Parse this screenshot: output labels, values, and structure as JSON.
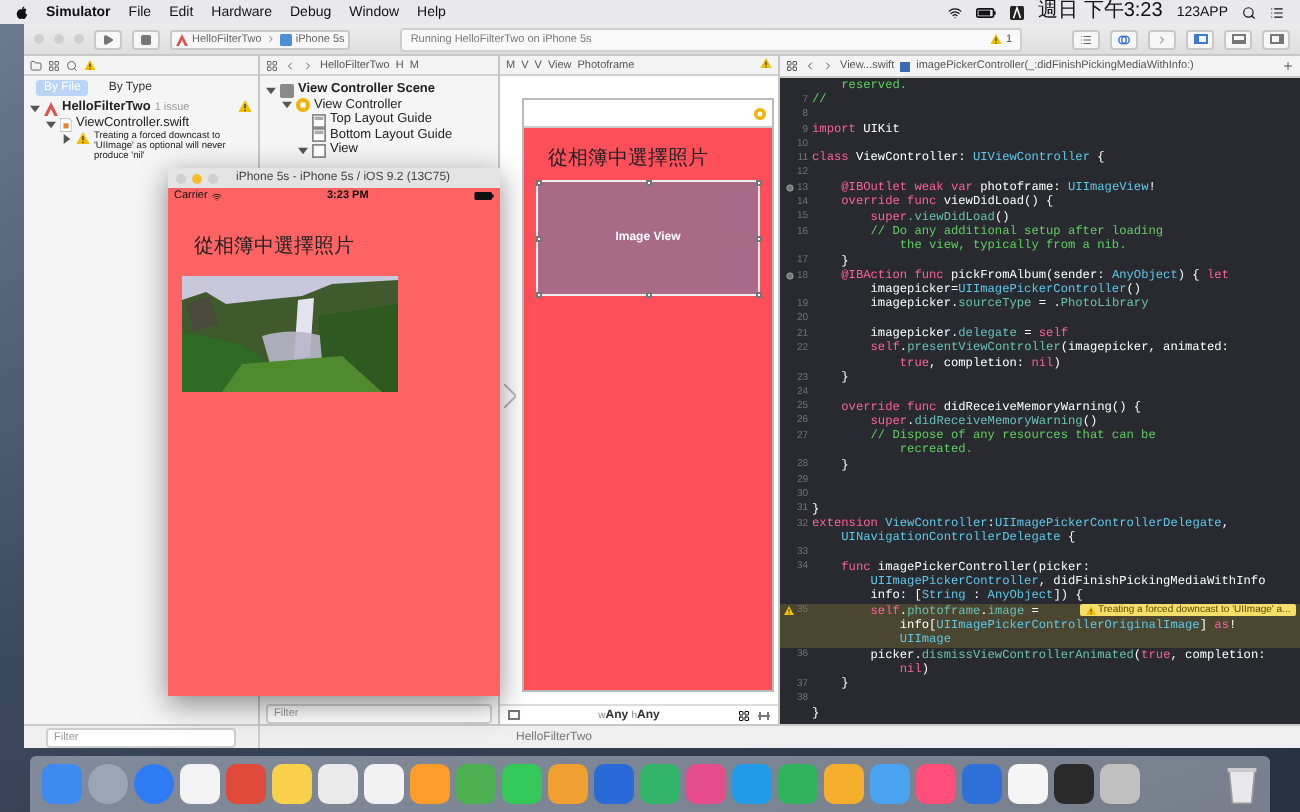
{
  "menu_bar": {
    "app": "Simulator",
    "items": [
      "File",
      "Edit",
      "Hardware",
      "Debug",
      "Window",
      "Help"
    ],
    "clock": "週日 下午3:23",
    "user": "123APP"
  },
  "toolbar": {
    "scheme": "HelloFilterTwo",
    "device": "iPhone 5s",
    "activity": "Running HelloFilterTwo on iPhone 5s",
    "issue_count": "1"
  },
  "navigator": {
    "filters": [
      {
        "label": "By File",
        "selected": true
      },
      {
        "label": "By Type",
        "selected": false
      }
    ],
    "issues": [
      {
        "label": "HelloFilterTwo",
        "kind": "project",
        "note": "1 issue",
        "expanded": true,
        "children": [
          {
            "label": "ViewController.swift",
            "kind": "file",
            "expanded": true,
            "children": [
              {
                "label": "Treating a forced downcast to 'UIImage' as optional will never produce 'nil'",
                "kind": "warning",
                "expanded": false
              }
            ]
          }
        ]
      }
    ],
    "filter_placeholder": "Filter"
  },
  "outline": {
    "path": [
      "HelloFilterTwo",
      "H",
      "M"
    ],
    "items": [
      {
        "label": "View Controller Scene",
        "kind": "scene",
        "expanded": true,
        "children": [
          {
            "label": "View Controller",
            "kind": "controller",
            "expanded": true,
            "children": [
              {
                "label": "Top Layout Guide",
                "kind": "guide"
              },
              {
                "label": "Bottom Layout Guide",
                "kind": "guide"
              },
              {
                "label": "View",
                "kind": "view",
                "expanded": true
              }
            ]
          }
        ]
      }
    ],
    "filter_placeholder": "Filter"
  },
  "canvas": {
    "path": [
      "M",
      "V",
      "V",
      "View",
      "Photoframe"
    ],
    "label": "從相簿中選擇照片",
    "image_view": "Image View",
    "size_class": [
      {
        "axis": "w",
        "value": "Any"
      },
      {
        "axis": "h",
        "value": "Any"
      }
    ]
  },
  "editor": {
    "path": [
      "View...swift",
      "imagePickerController(_:didFinishPickingMediaWithInfo:)"
    ],
    "rows": [
      {
        "i": "    ",
        "tk": [
          {
            "text": "reserved.",
            "kind": "comment"
          }
        ]
      },
      {
        "n": "7",
        "tk": [
          {
            "text": "//",
            "kind": "comment"
          }
        ]
      },
      {
        "n": "8"
      },
      {
        "n": "9",
        "tk": [
          {
            "text": "import",
            "kind": "keyword"
          },
          {
            "text": " UIKit",
            "kind": "plain"
          }
        ]
      },
      {
        "n": "10"
      },
      {
        "n": "11",
        "tk": [
          {
            "text": "class",
            "kind": "keyword"
          },
          {
            "text": " ViewController: ",
            "kind": "plain"
          },
          {
            "text": "UIViewController",
            "kind": "type"
          },
          {
            "text": " {",
            "kind": "plain"
          }
        ]
      },
      {
        "n": "12"
      },
      {
        "n": "13",
        "outlet": true,
        "i": "    ",
        "tk": [
          {
            "text": "@IBOutlet weak var",
            "kind": "keyword"
          },
          {
            "text": " photoframe: ",
            "kind": "plain"
          },
          {
            "text": "UIImageView",
            "kind": "type"
          },
          {
            "text": "!",
            "kind": "plain"
          }
        ]
      },
      {
        "n": "14",
        "i": "    ",
        "tk": [
          {
            "text": "override func",
            "kind": "keyword"
          },
          {
            "text": " viewDidLoad() {",
            "kind": "plain"
          }
        ]
      },
      {
        "n": "15",
        "i": "        ",
        "tk": [
          {
            "text": "super",
            "kind": "keyword"
          },
          {
            "text": ".viewDidLoad",
            "kind": "member"
          },
          {
            "text": "()",
            "kind": "plain"
          }
        ]
      },
      {
        "n": "16",
        "i": "        ",
        "tk": [
          {
            "text": "// Do any additional setup after loading",
            "kind": "comment"
          }
        ]
      },
      {
        "i": "            ",
        "tk": [
          {
            "text": "the view, typically from a nib.",
            "kind": "comment"
          }
        ]
      },
      {
        "n": "17",
        "i": "    ",
        "tk": [
          {
            "text": "}",
            "kind": "plain"
          }
        ]
      },
      {
        "n": "18",
        "outlet": true,
        "i": "    ",
        "tk": [
          {
            "text": "@IBAction func",
            "kind": "keyword"
          },
          {
            "text": " pickFromAlbum(sender: ",
            "kind": "plain"
          },
          {
            "text": "AnyObject",
            "kind": "type"
          },
          {
            "text": ") { ",
            "kind": "plain"
          },
          {
            "text": "let",
            "kind": "keyword"
          }
        ]
      },
      {
        "i": "        ",
        "tk": [
          {
            "text": "imagepicker=",
            "kind": "plain"
          },
          {
            "text": "UIImagePickerController",
            "kind": "type"
          },
          {
            "text": "()",
            "kind": "plain"
          }
        ]
      },
      {
        "n": "19",
        "i": "        ",
        "tk": [
          {
            "text": "imagepicker.",
            "kind": "plain"
          },
          {
            "text": "sourceType",
            "kind": "member"
          },
          {
            "text": " = .",
            "kind": "plain"
          },
          {
            "text": "PhotoLibrary",
            "kind": "member"
          }
        ]
      },
      {
        "n": "20"
      },
      {
        "n": "21",
        "i": "        ",
        "tk": [
          {
            "text": "imagepicker.",
            "kind": "plain"
          },
          {
            "text": "delegate",
            "kind": "member"
          },
          {
            "text": " = ",
            "kind": "plain"
          },
          {
            "text": "self",
            "kind": "keyword"
          }
        ]
      },
      {
        "n": "22",
        "i": "        ",
        "tk": [
          {
            "text": "self",
            "kind": "keyword"
          },
          {
            "text": ".",
            "kind": "plain"
          },
          {
            "text": "presentViewController",
            "kind": "member"
          },
          {
            "text": "(imagepicker, animated:",
            "kind": "plain"
          }
        ]
      },
      {
        "i": "            ",
        "tk": [
          {
            "text": "true",
            "kind": "keyword"
          },
          {
            "text": ", completion: ",
            "kind": "plain"
          },
          {
            "text": "nil",
            "kind": "keyword"
          },
          {
            "text": ")",
            "kind": "plain"
          }
        ]
      },
      {
        "n": "23",
        "i": "    ",
        "tk": [
          {
            "text": "}",
            "kind": "plain"
          }
        ]
      },
      {
        "n": "24"
      },
      {
        "n": "25",
        "i": "    ",
        "tk": [
          {
            "text": "override func",
            "kind": "keyword"
          },
          {
            "text": " didReceiveMemoryWarning() {",
            "kind": "plain"
          }
        ]
      },
      {
        "n": "26",
        "i": "        ",
        "tk": [
          {
            "text": "super",
            "kind": "keyword"
          },
          {
            "text": ".",
            "kind": "plain"
          },
          {
            "text": "didReceiveMemoryWarning",
            "kind": "member"
          },
          {
            "text": "()",
            "kind": "plain"
          }
        ]
      },
      {
        "n": "27",
        "i": "        ",
        "tk": [
          {
            "text": "// Dispose of any resources that can be",
            "kind": "comment"
          }
        ]
      },
      {
        "i": "            ",
        "tk": [
          {
            "text": "recreated.",
            "kind": "comment"
          }
        ]
      },
      {
        "n": "28",
        "i": "    ",
        "tk": [
          {
            "text": "}",
            "kind": "plain"
          }
        ]
      },
      {
        "n": "29"
      },
      {
        "n": "30"
      },
      {
        "n": "31",
        "tk": [
          {
            "text": "}",
            "kind": "plain"
          }
        ]
      },
      {
        "n": "32",
        "tk": [
          {
            "text": "extension",
            "kind": "keyword"
          },
          {
            "text": " ViewController",
            "kind": "type"
          },
          {
            "text": ":",
            "kind": "plain"
          },
          {
            "text": "UIImagePickerControllerDelegate",
            "kind": "type"
          },
          {
            "text": ",",
            "kind": "plain"
          }
        ]
      },
      {
        "i": "    ",
        "tk": [
          {
            "text": "UINavigationControllerDelegate",
            "kind": "type"
          },
          {
            "text": " {",
            "kind": "plain"
          }
        ]
      },
      {
        "n": "33"
      },
      {
        "n": "34",
        "i": "    ",
        "tk": [
          {
            "text": "func",
            "kind": "keyword"
          },
          {
            "text": " imagePickerController(picker:",
            "kind": "plain"
          }
        ]
      },
      {
        "i": "        ",
        "tk": [
          {
            "text": "UIImagePickerController",
            "kind": "type"
          },
          {
            "text": ", didFinishPickingMediaWithInfo",
            "kind": "plain"
          }
        ]
      },
      {
        "i": "        ",
        "tk": [
          {
            "text": "info: [",
            "kind": "plain"
          },
          {
            "text": "String",
            "kind": "type"
          },
          {
            "text": " : ",
            "kind": "plain"
          },
          {
            "text": "AnyObject",
            "kind": "type"
          },
          {
            "text": "]) {",
            "kind": "plain"
          }
        ]
      },
      {
        "n": "35",
        "warning": true,
        "issue": "Treating a forced downcast to 'UIImage' a...",
        "i": "        ",
        "tk": [
          {
            "text": "self",
            "kind": "keyword"
          },
          {
            "text": ".",
            "kind": "plain"
          },
          {
            "text": "photoframe",
            "kind": "member"
          },
          {
            "text": ".",
            "kind": "plain"
          },
          {
            "text": "image",
            "kind": "member"
          },
          {
            "text": " =",
            "kind": "plain"
          }
        ]
      },
      {
        "warning": true,
        "i": "            ",
        "tk": [
          {
            "text": "info[",
            "kind": "plain"
          },
          {
            "text": "UIImagePickerControllerOriginalImage",
            "kind": "type"
          },
          {
            "text": "] ",
            "kind": "plain"
          },
          {
            "text": "as",
            "kind": "keyword"
          },
          {
            "text": "!",
            "kind": "plain"
          }
        ]
      },
      {
        "warning": true,
        "i": "            ",
        "tk": [
          {
            "text": "UIImage",
            "kind": "type"
          }
        ]
      },
      {
        "n": "36",
        "i": "        ",
        "tk": [
          {
            "text": "picker.",
            "kind": "plain"
          },
          {
            "text": "dismissViewControllerAnimated",
            "kind": "member"
          },
          {
            "text": "(",
            "kind": "plain"
          },
          {
            "text": "true",
            "kind": "keyword"
          },
          {
            "text": ", completion:",
            "kind": "plain"
          }
        ]
      },
      {
        "i": "            ",
        "tk": [
          {
            "text": "nil",
            "kind": "keyword"
          },
          {
            "text": ")",
            "kind": "plain"
          }
        ]
      },
      {
        "n": "37",
        "i": "    ",
        "tk": [
          {
            "text": "}",
            "kind": "plain"
          }
        ]
      },
      {
        "n": "38"
      },
      {
        "tk": [
          {
            "text": "}",
            "kind": "plain"
          }
        ]
      }
    ]
  },
  "debug_bar": {
    "target": "HelloFilterTwo"
  },
  "simulator": {
    "title": "iPhone 5s - iPhone 5s / iOS 9.2 (13C75)",
    "carrier": "Carrier",
    "time": "3:23 PM",
    "label": "從相簿中選擇照片"
  }
}
